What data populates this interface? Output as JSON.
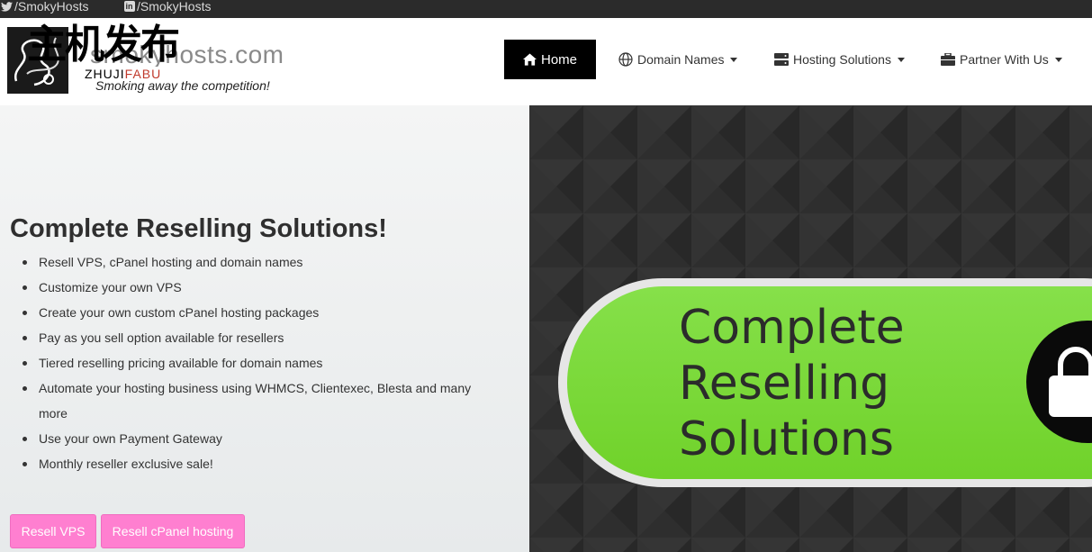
{
  "social": {
    "twitter": "/SmokyHosts",
    "linkedin": "/SmokyHosts",
    "linkedin_glyph": "in"
  },
  "logo": {
    "domain_text": "smokyhosts.com",
    "watermark_cn": "主机发布",
    "watermark_en_a": "ZHUJI",
    "watermark_en_b": "FABU",
    "tagline": "Smoking away the competition!"
  },
  "nav": {
    "home": "Home",
    "domains": "Domain Names",
    "hosting": "Hosting Solutions",
    "partner": "Partner With Us"
  },
  "hero": {
    "title": "Complete Reselling Solutions!",
    "features": [
      "Resell VPS, cPanel hosting and domain names",
      "Customize your own VPS",
      "Create your own custom cPanel hosting packages",
      "Pay as you sell option available for resellers",
      "Tiered reselling pricing available for domain names",
      "Automate your hosting business using WHMCS, Clientexec, Blesta and many more",
      "Use your own Payment Gateway",
      "Monthly reseller exclusive sale!"
    ],
    "btn_vps": "Resell VPS",
    "btn_cpanel": "Resell cPanel hosting"
  },
  "banner": {
    "line1": "Complete",
    "line2": "Reselling",
    "line3": "Solutions"
  },
  "colors": {
    "topbar": "#2b2b2b",
    "nav_active": "#000000",
    "button": "#ff7fd0",
    "banner_green": "#7ddc3a"
  },
  "icons": [
    "twitter-icon",
    "linkedin-icon",
    "home-icon",
    "globe-icon",
    "server-icon",
    "briefcase-icon",
    "shopping-bag-icon",
    "logo-smoke-icon"
  ]
}
